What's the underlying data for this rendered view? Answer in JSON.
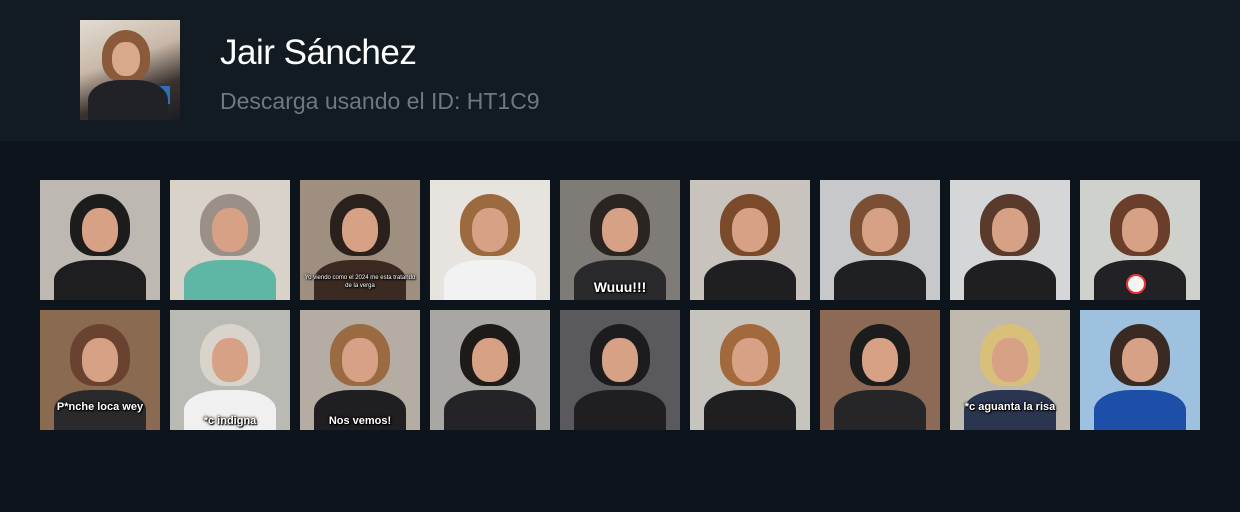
{
  "profile": {
    "name": "Jair Sánchez",
    "subtitle": "Descarga usando el ID: HT1C9",
    "avatar_icon": "profile-photo"
  },
  "videos": [
    {
      "caption": "",
      "bg": "#bdb8b2",
      "hair": "#1c1c1c",
      "body": "#1e1e20"
    },
    {
      "caption": "",
      "bg": "#d8d2c9",
      "hair": "#9a9088",
      "body": "#5fb6a4"
    },
    {
      "caption": "Yo viendo como el 2024 me esta tratando de la verga",
      "bg": "#9e8f80",
      "hair": "#2a211c",
      "body": "#3a2a22"
    },
    {
      "caption": "",
      "bg": "#e7e4df",
      "hair": "#9b6a3e",
      "body": "#f2f2f2"
    },
    {
      "caption": "Wuuu!!!",
      "bg": "#7f7b76",
      "hair": "#2b2522",
      "body": "#2a2a2c"
    },
    {
      "caption": "",
      "bg": "#c9c3bd",
      "hair": "#7b4a2a",
      "body": "#1f1f22"
    },
    {
      "caption": "",
      "bg": "#c6c8cc",
      "hair": "#7a4f33",
      "body": "#1f2024"
    },
    {
      "caption": "",
      "bg": "#d5d6d8",
      "hair": "#5a3a2a",
      "body": "#1f1f22"
    },
    {
      "caption": "",
      "bg": "#cfd2cc",
      "hair": "#6a3e2a",
      "body": "#222226"
    },
    {
      "caption": "P*nche loca wey",
      "bg": "#8a6a50",
      "hair": "#6a4330",
      "body": "#2a2a2c"
    },
    {
      "caption": "*c indigna",
      "bg": "#b9bab4",
      "hair": "#d8d4cc",
      "body": "#f0f0f0"
    },
    {
      "caption": "Nos vemos!",
      "bg": "#b5aca4",
      "hair": "#9a6a42",
      "body": "#1f1f22"
    },
    {
      "caption": "",
      "bg": "#a9a7a4",
      "hair": "#1e1a18",
      "body": "#242428"
    },
    {
      "caption": "",
      "bg": "#5a5a5e",
      "hair": "#1c1c1e",
      "body": "#1f1f22"
    },
    {
      "caption": "",
      "bg": "#c7c3bd",
      "hair": "#a26a3c",
      "body": "#1f1f22"
    },
    {
      "caption": "",
      "bg": "#8d6a56",
      "hair": "#1c1c1c",
      "body": "#262629"
    },
    {
      "caption": "*c aguanta la risa",
      "bg": "#bfb9ae",
      "hair": "#d9c07a",
      "body": "#2a3550"
    },
    {
      "caption": "",
      "bg": "#9ec1df",
      "hair": "#3a2a22",
      "body": "#1e4fa8"
    }
  ]
}
